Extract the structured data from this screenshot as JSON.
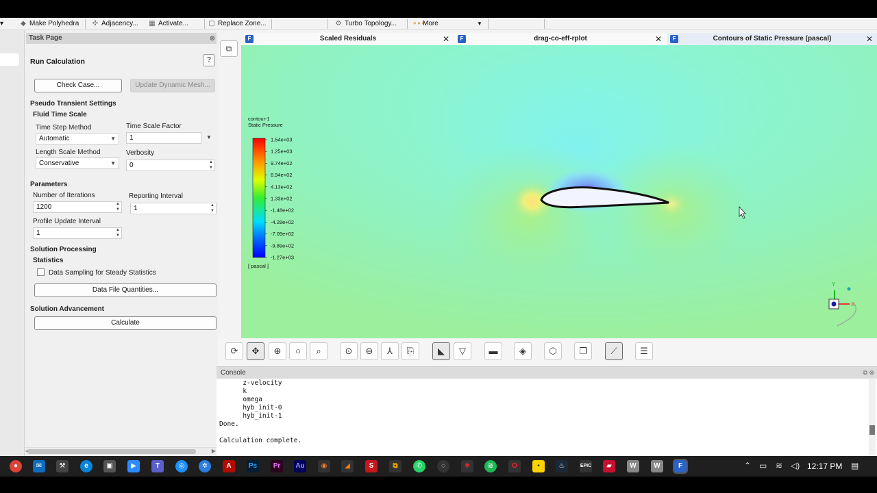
{
  "ribbon": {
    "items": [
      "Make Polyhedra",
      "Adjacency...",
      "Activate...",
      "Replace Zone...",
      "Turbo Topology...",
      "More"
    ]
  },
  "task_page": {
    "header": "Task Page",
    "title": "Run Calculation",
    "help": "?",
    "check_case": "Check Case...",
    "update_dynamic_mesh": "Update Dynamic Mesh...",
    "pseudo_transient": "Pseudo Transient Settings",
    "fluid_time_scale": "Fluid Time Scale",
    "time_step_method_label": "Time Step Method",
    "time_step_method_value": "Automatic",
    "time_scale_factor_label": "Time Scale Factor",
    "time_scale_factor_value": "1",
    "length_scale_method_label": "Length Scale Method",
    "length_scale_method_value": "Conservative",
    "verbosity_label": "Verbosity",
    "verbosity_value": "0",
    "parameters": "Parameters",
    "num_iterations_label": "Number of Iterations",
    "num_iterations_value": "1200",
    "reporting_interval_label": "Reporting Interval",
    "reporting_interval_value": "1",
    "profile_update_label": "Profile Update Interval",
    "profile_update_value": "1",
    "solution_processing": "Solution Processing",
    "statistics": "Statistics",
    "data_sampling": "Data Sampling for Steady Statistics",
    "data_file_quantities": "Data File Quantities...",
    "solution_advancement": "Solution Advancement",
    "calculate": "Calculate"
  },
  "graphics_tabs": [
    {
      "label": "Scaled Residuals"
    },
    {
      "label": "drag-co-eff-rplot"
    },
    {
      "label": "Contours of Static Pressure (pascal)"
    }
  ],
  "legend": {
    "name": "contour-1",
    "quantity": "Static Pressure",
    "unit": "[ pascal ]",
    "ticks": [
      "1.54e+03",
      "1.25e+03",
      "9.74e+02",
      "6.94e+02",
      "4.13e+02",
      "1.33e+02",
      "-1.48e+02",
      "-4.28e+02",
      "-7.09e+02",
      "-9.89e+02",
      "-1.27e+03"
    ]
  },
  "axes_triad": {
    "x": "X",
    "y": "Y"
  },
  "console": {
    "title": "Console",
    "lines": [
      "      z-velocity",
      "      k",
      "      omega",
      "      hyb_init-0",
      "      hyb_init-1",
      "Done.",
      "",
      "Calculation complete."
    ]
  },
  "taskbar": {
    "clock": "12:17 PM"
  },
  "colors": {
    "field": "#8ef0b8",
    "accent": "#2a63c7"
  }
}
